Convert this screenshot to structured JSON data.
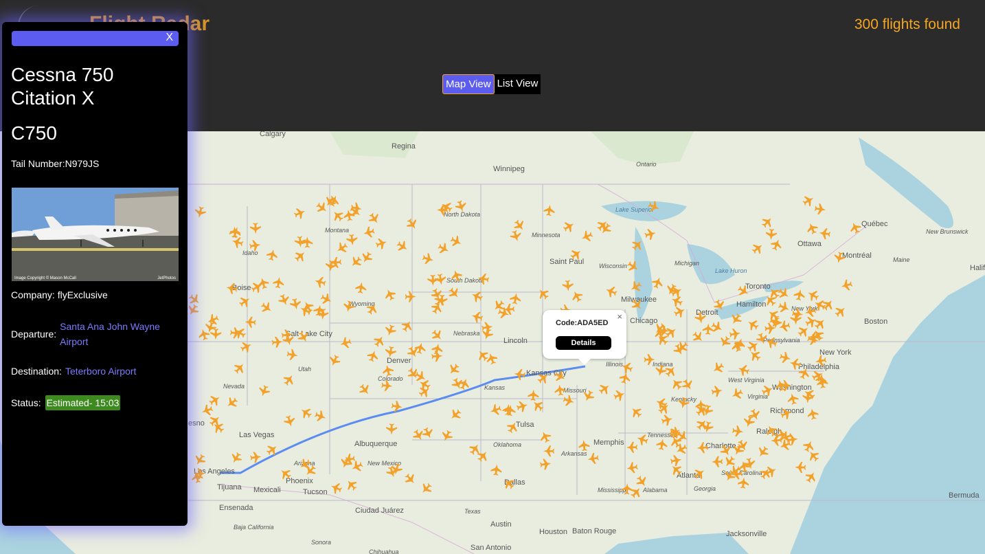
{
  "header": {
    "brand": "Flight Radar",
    "flights_found": "300 flights found"
  },
  "view_toggle": {
    "map_label": "Map View",
    "list_label": "List View"
  },
  "map": {
    "labels": {
      "calgary": "Calgary",
      "regina": "Regina",
      "winnipeg": "Winnipeg",
      "ontario": "Ontario",
      "montana": "Montana",
      "north_dakota": "North Dakota",
      "minnesota": "Minnesota",
      "lake_superior": "Lake Superior",
      "quebec": "Québec",
      "ottawa": "Ottawa",
      "montreal": "Montréal",
      "idaho": "Idaho",
      "south_dakota": "South Dakota",
      "saint_paul": "Saint Paul",
      "wisconsin": "Wisconsin",
      "michigan": "Michigan",
      "lake_huron": "Lake Huron",
      "boise": "Boise",
      "wyoming": "Wyoming",
      "milwaukee": "Milwaukee",
      "toronto": "Toronto",
      "hamilton": "Hamilton",
      "maine": "Maine",
      "new_brunswick": "New Brunswick",
      "halifax": "Halif",
      "salt_lake_city": "Salt Lake City",
      "nebraska": "Nebraska",
      "lincoln": "Lincoln",
      "chicago": "Chicago",
      "detroit": "Detroit",
      "new_york_state": "New York",
      "boston": "Boston",
      "pennsylvania": "Pennsylvania",
      "new_york": "New York",
      "philadelphia": "Philadelphia",
      "denver": "Denver",
      "kansas_city": "Kansas City",
      "illinois": "Illinois",
      "indiana": "Indiana",
      "utah": "Utah",
      "colorado": "Colorado",
      "kansas": "Kansas",
      "missouri": "Missouri",
      "nevada": "Nevada",
      "west_virginia": "West Virginia",
      "washington": "Washington",
      "kentucky": "Kentucky",
      "virginia": "Virginia",
      "richmond": "Richmond",
      "las_vegas": "Las Vegas",
      "tulsa": "Tulsa",
      "memphis": "Memphis",
      "tennessee": "Tennessee",
      "raleigh": "Raleigh",
      "albuquerque": "Albuquerque",
      "oklahoma": "Oklahoma",
      "arkansas": "Arkansas",
      "charlotte": "Charlotte",
      "arizona": "Arizona",
      "new_mexico": "New Mexico",
      "los_angeles": "Los Angeles",
      "phoenix": "Phoenix",
      "atlanta": "Atlanta",
      "georgia": "Georgia",
      "south_carolina": "South Carolina",
      "dallas": "Dallas",
      "mississippi": "Mississippi",
      "alabama": "Alabama",
      "tijuana": "Tijuana",
      "mexicali": "Mexicali",
      "tucson": "Tucson",
      "bermuda": "Bermuda",
      "ensenada": "Ensenada",
      "ciudad_juarez": "Ciudad Juárez",
      "texas": "Texas",
      "austin": "Austin",
      "houston": "Houston",
      "baton_rouge": "Baton Rouge",
      "jacksonville": "Jacksonville",
      "baja_california": "Baja California",
      "sonora": "Sonora",
      "san_antonio": "San Antonio",
      "chihuahua": "Chihuahua",
      "fresno": "esno"
    }
  },
  "popup": {
    "code": "Code:ADA5ED",
    "details_label": "Details",
    "close": "×"
  },
  "panel": {
    "close_label": "X",
    "aircraft_name": "Cessna 750 Citation X",
    "aircraft_code": "C750",
    "tail_number": "Tail Number:N979JS",
    "photo_credit": "Image Copyright © Mason McCall",
    "photo_source": "JetPhotos",
    "company": "Company: flyExclusive",
    "departure_label": "Departure:",
    "departure_airport": "Santa Ana John Wayne Airport",
    "destination_label": "Destination:",
    "destination_airport": "Teterboro Airport",
    "status_label": "Status:",
    "status_value": "Estimated- 15:03",
    "status_color": "#3d8b1e"
  },
  "colors": {
    "accent": "#5c5cf0",
    "brand": "#f5a623",
    "plane": "#f2a22b",
    "route": "#5b8cf0"
  }
}
